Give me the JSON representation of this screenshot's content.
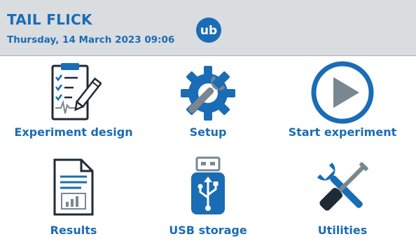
{
  "header": {
    "title": "TAIL FLICK",
    "datetime": "Thursday, 14 March 2023 09:06",
    "logo_text": "ub"
  },
  "menu": {
    "items": [
      {
        "label": "Experiment design",
        "icon": "clipboard-pencil-icon"
      },
      {
        "label": "Setup",
        "icon": "gear-wrench-icon"
      },
      {
        "label": "Start experiment",
        "icon": "play-circle-icon"
      },
      {
        "label": "Results",
        "icon": "document-chart-icon"
      },
      {
        "label": "USB storage",
        "icon": "usb-drive-icon"
      },
      {
        "label": "Utilities",
        "icon": "tools-icon"
      }
    ]
  },
  "colors": {
    "accent": "#1a6cb5",
    "header_bg": "#d9dde0",
    "icon_dark": "#1f2a35",
    "icon_grey": "#7a8790"
  }
}
